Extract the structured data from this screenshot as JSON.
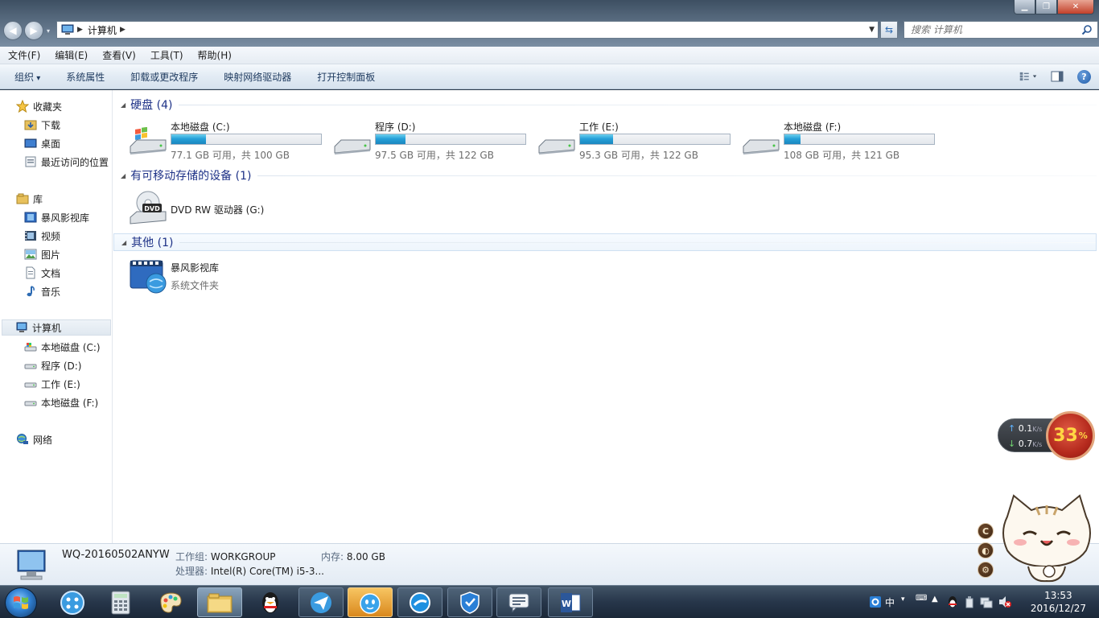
{
  "window": {
    "address_crumb": "计算机",
    "search_placeholder": "搜索 计算机"
  },
  "menu": [
    "文件(F)",
    "编辑(E)",
    "查看(V)",
    "工具(T)",
    "帮助(H)"
  ],
  "toolbar": {
    "organize": "组织",
    "system_props": "系统属性",
    "uninstall": "卸载或更改程序",
    "map_drive": "映射网络驱动器",
    "control_panel": "打开控制面板"
  },
  "sidebar": {
    "favorites": "收藏夹",
    "downloads": "下载",
    "desktop": "桌面",
    "recent": "最近访问的位置",
    "libraries": "库",
    "baofeng": "暴风影视库",
    "videos": "视频",
    "pictures": "图片",
    "documents": "文档",
    "music": "音乐",
    "computer": "计算机",
    "drive_c": "本地磁盘 (C:)",
    "drive_d": "程序 (D:)",
    "drive_e": "工作 (E:)",
    "drive_f": "本地磁盘 (F:)",
    "network": "网络"
  },
  "groups": {
    "hdd": "硬盘 (4)",
    "removable": "有可移动存储的设备 (1)",
    "other": "其他 (1)"
  },
  "drives": [
    {
      "name": "本地磁盘 (C:)",
      "free": "77.1 GB 可用，共 100 GB",
      "used_fraction": 0.23
    },
    {
      "name": "程序 (D:)",
      "free": "97.5 GB 可用，共 122 GB",
      "used_fraction": 0.2
    },
    {
      "name": "工作 (E:)",
      "free": "95.3 GB 可用，共 122 GB",
      "used_fraction": 0.22
    },
    {
      "name": "本地磁盘 (F:)",
      "free": "108 GB 可用，共 121 GB",
      "used_fraction": 0.11
    }
  ],
  "dvd": {
    "name": "DVD RW 驱动器 (G:)",
    "badge": "DVD"
  },
  "other_item": {
    "name": "暴风影视库",
    "sub": "系统文件夹"
  },
  "details": {
    "computer_name": "WQ-20160502ANYW",
    "workgroup_label": "工作组:",
    "workgroup": "WORKGROUP",
    "memory_label": "内存:",
    "memory": "8.00 GB",
    "cpu_label": "处理器:",
    "cpu": "Intel(R) Core(TM) i5-3..."
  },
  "netmon": {
    "up": "0.1",
    "down": "0.7",
    "unit": "K/s",
    "cpu_percent": "33",
    "pct_sign": "%"
  },
  "tray": {
    "ime": "中",
    "time": "13:53",
    "date": "2016/12/27"
  },
  "colors": {
    "accent": "#26a0d8",
    "group_header": "#1e3287",
    "taskbar": "#27364a"
  }
}
